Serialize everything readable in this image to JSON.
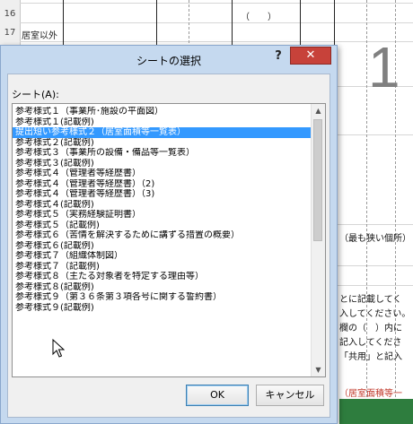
{
  "spreadsheet": {
    "row_numbers": [
      "16",
      "17"
    ],
    "row17_text": "居室以外",
    "paren_text": "（　　）",
    "big_number": "1",
    "right_fragments": [
      "（最も狭い個所）",
      "とに記載してく",
      "入してください。",
      "欄の（　）内に",
      "記入してくださ",
      "「共用」と記入"
    ],
    "red_fragment": "（居室面積等一"
  },
  "dialog": {
    "title": "シートの選択",
    "help_glyph": "?",
    "close_glyph": "✕",
    "sheet_label": "シート(A):",
    "selected_index": 2,
    "items": [
      "参考様式１（事業所･施設の平面図）",
      "参考様式１(記載例)",
      "提出短い参考様式２（居室面積等一覧表）",
      "参考様式２(記載例)",
      "参考様式３（事業所の設備・備品等一覧表）",
      "参考様式３(記載例)",
      "参考様式４（管理者等経歴書）",
      "参考様式４（管理者等経歴書）（2)",
      "参考様式４（管理者等経歴書）（3)",
      "参考様式４(記載例)",
      "参考様式５（実務経験証明書）",
      "参考様式５（記載例)",
      "参考様式６（苦情を解決するために講ずる措置の概要）",
      "参考様式６(記載例)",
      "参考様式７（組織体制図）",
      "参考様式７（記載例)",
      "参考様式８（主たる対象者を特定する理由等）",
      "参考様式８(記載例)",
      "参考様式９（第３６条第３項各号に関する誓約書）",
      "参考様式９(記載例)"
    ],
    "scroll_up_glyph": "▲",
    "scroll_down_glyph": "▼",
    "ok_label": "OK",
    "cancel_label": "キャンセル"
  }
}
